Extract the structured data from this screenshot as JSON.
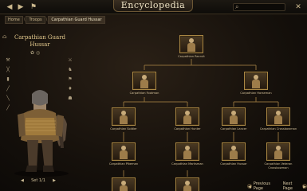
{
  "window": {
    "title": "Encyclopedia",
    "search_placeholder": ""
  },
  "breadcrumb": [
    {
      "label": "Home"
    },
    {
      "label": "Troops"
    },
    {
      "label": "Carpathian Guard Hussar"
    }
  ],
  "unit": {
    "name_line1": "Carpathian Guard",
    "name_line2": "Hussar",
    "set_label": "Set 1/1"
  },
  "tree": [
    {
      "id": "recruit",
      "label": "Carpathian Recruit"
    },
    {
      "id": "footman",
      "label": "Carpathian Footman"
    },
    {
      "id": "horseman",
      "label": "Carpathian Horseman"
    },
    {
      "id": "soldier",
      "label": "Carpathian Soldier"
    },
    {
      "id": "hunter",
      "label": "Carpathian Hunter"
    },
    {
      "id": "lancer",
      "label": "Carpathian Lancer"
    },
    {
      "id": "crossbowman",
      "label": "Carpathian Crossbowman"
    },
    {
      "id": "pikeman",
      "label": "Carpathian Pikeman"
    },
    {
      "id": "marksman",
      "label": "Carpathian Marksman"
    },
    {
      "id": "hussar",
      "label": "Carpathian Hussar"
    },
    {
      "id": "veteran",
      "label": "Carpathian Veteran Crossbowman"
    }
  ],
  "nav": {
    "prev": "Previous Page",
    "next": "Next Page"
  },
  "colors": {
    "accent": "#a98744",
    "text": "#d8c9a5",
    "background": "#15100b"
  }
}
